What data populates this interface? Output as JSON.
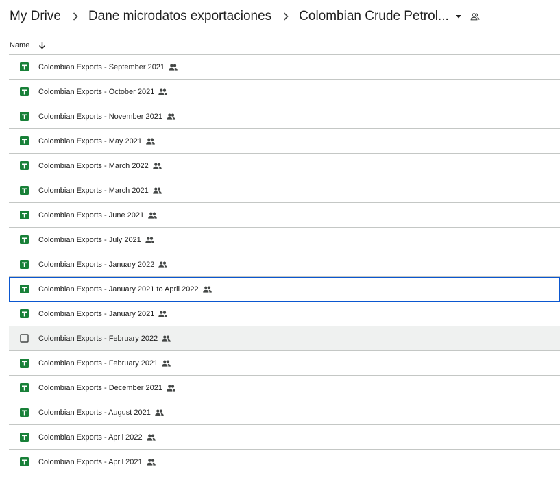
{
  "breadcrumb": {
    "root": "My Drive",
    "parent": "Dane microdatos exportaciones",
    "current": "Colombian Crude Petrol..."
  },
  "header": {
    "name_label": "Name",
    "sort_direction": "descending"
  },
  "colors": {
    "sheets_green": "#188038",
    "focus_blue": "#0b57d0",
    "hover_bg": "#eff1f0",
    "divider": "#c4c7c5"
  },
  "files": [
    {
      "name": "Colombian Exports - September 2021",
      "icon": "google-sheets-icon",
      "shared": true
    },
    {
      "name": "Colombian Exports - October 2021",
      "icon": "google-sheets-icon",
      "shared": true
    },
    {
      "name": "Colombian Exports - November 2021",
      "icon": "google-sheets-icon",
      "shared": true
    },
    {
      "name": "Colombian Exports - May 2021",
      "icon": "google-sheets-icon",
      "shared": true
    },
    {
      "name": "Colombian Exports - March 2022",
      "icon": "google-sheets-icon",
      "shared": true
    },
    {
      "name": "Colombian Exports - March 2021",
      "icon": "google-sheets-icon",
      "shared": true
    },
    {
      "name": "Colombian Exports - June 2021",
      "icon": "google-sheets-icon",
      "shared": true
    },
    {
      "name": "Colombian Exports - July 2021",
      "icon": "google-sheets-icon",
      "shared": true
    },
    {
      "name": "Colombian Exports - January 2022",
      "icon": "google-sheets-icon",
      "shared": true
    },
    {
      "name": "Colombian Exports - January 2021 to April 2022",
      "icon": "google-sheets-icon",
      "shared": true,
      "state": "focused"
    },
    {
      "name": "Colombian Exports - January 2021",
      "icon": "google-sheets-icon",
      "shared": true
    },
    {
      "name": "Colombian Exports - February 2022",
      "icon": "checkbox-icon",
      "shared": true,
      "state": "hovered"
    },
    {
      "name": "Colombian Exports - February 2021",
      "icon": "google-sheets-icon",
      "shared": true
    },
    {
      "name": "Colombian Exports - December 2021",
      "icon": "google-sheets-icon",
      "shared": true
    },
    {
      "name": "Colombian Exports - August 2021",
      "icon": "google-sheets-icon",
      "shared": true
    },
    {
      "name": "Colombian Exports - April 2022",
      "icon": "google-sheets-icon",
      "shared": true
    },
    {
      "name": "Colombian Exports - April 2021",
      "icon": "google-sheets-icon",
      "shared": true
    }
  ]
}
